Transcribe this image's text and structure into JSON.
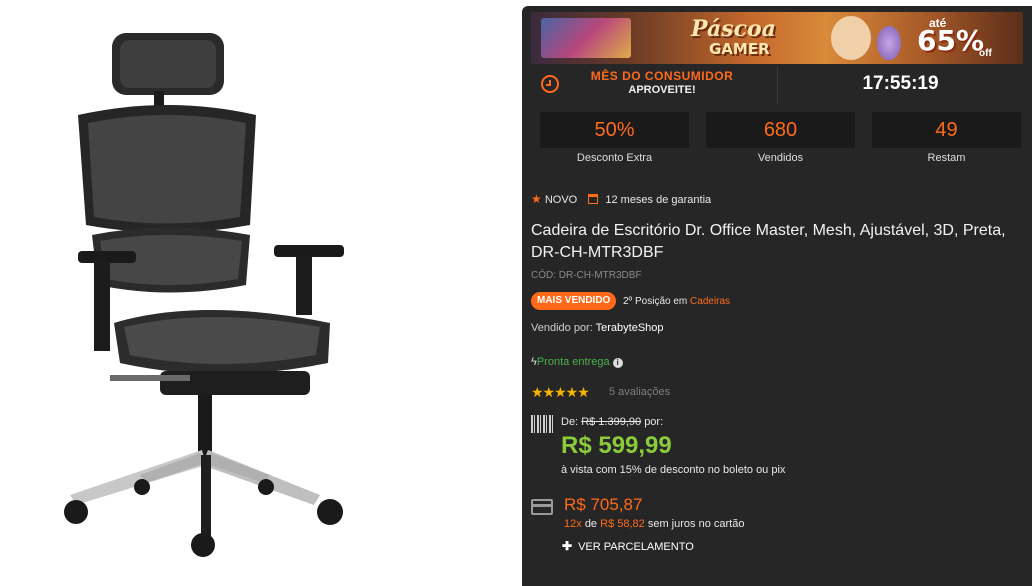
{
  "banner": {
    "line1": "Páscoa",
    "line2": "GAMER",
    "ate": "até",
    "pct": "65%",
    "off": "off"
  },
  "promo": {
    "title": "MÊS DO CONSUMIDOR",
    "subtitle": "APROVEITE!",
    "timer": "17:55:19"
  },
  "stats": [
    {
      "value": "50%",
      "label": "Desconto Extra"
    },
    {
      "value": "680",
      "label": "Vendidos"
    },
    {
      "value": "49",
      "label": "Restam"
    }
  ],
  "product": {
    "novo": "NOVO",
    "garantia": "12 meses de garantia",
    "title": "Cadeira de Escritório Dr. Office Master, Mesh, Ajustável, 3D, Preta, DR-CH-MTR3DBF",
    "code": "CÓD: DR-CH-MTR3DBF",
    "badge": "MAIS VENDIDO",
    "position": "2º Posição em",
    "category": "Cadeiras",
    "seller_label": "Vendido por:",
    "seller": "TerabyteShop",
    "stock": "Pronta entrega",
    "rating": 5,
    "stars": "★★★★★",
    "reviews": "5 avaliações"
  },
  "pricing": {
    "de_label": "De:",
    "old_price": "R$ 1.399,90",
    "por_label": "por:",
    "price": "R$ 599,99",
    "cash_note": "à vista com 15% de desconto no boleto ou pix",
    "card_price": "R$ 705,87",
    "installments": "12x",
    "de_word": "de",
    "installment_value": "R$ 58,82",
    "installment_note": "sem juros no cartão",
    "ver_parcelamento": "VER PARCELAMENTO"
  },
  "colors": {
    "accent": "#ff6a1a",
    "price_green": "#8acb3a",
    "panel_bg": "#262626",
    "stock_green": "#49b04a",
    "star": "#f7b500"
  }
}
